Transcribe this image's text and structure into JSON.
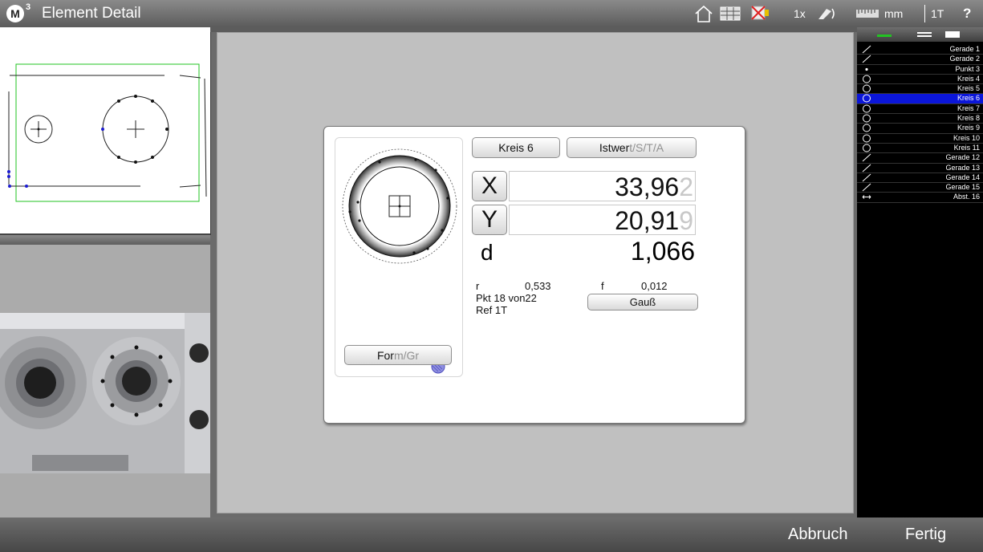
{
  "app": {
    "logo": "M",
    "logo_sup": "3",
    "title": "Element Detail"
  },
  "toolbar": {
    "zoom": "1x",
    "unit": "mm",
    "ref": "1T",
    "help": "?"
  },
  "dialog": {
    "name_button": "Kreis 6",
    "mode_button_main": "Istwer",
    "mode_button_dim": "t/S/T/A",
    "form_button_main": "For",
    "form_button_dim": "m/Gr",
    "x_label": "X",
    "x_value_main": "33,96",
    "x_value_ghost": "2",
    "y_label": "Y",
    "y_value_main": "20,91",
    "y_value_ghost": "9",
    "d_label": "d",
    "d_value": "1,066",
    "r_label": "r",
    "r_value": "0,533",
    "f_label": "f",
    "f_value": "0,012",
    "points": "Pkt 18 von22",
    "ref": "Ref 1T",
    "fit_button": "Gauß"
  },
  "elements": [
    {
      "icon": "line",
      "label": "Gerade 1"
    },
    {
      "icon": "line",
      "label": "Gerade 2"
    },
    {
      "icon": "point",
      "label": "Punkt 3"
    },
    {
      "icon": "circle",
      "label": "Kreis 4"
    },
    {
      "icon": "circle",
      "label": "Kreis 5"
    },
    {
      "icon": "circle",
      "label": "Kreis 6",
      "selected": true
    },
    {
      "icon": "circle",
      "label": "Kreis 7"
    },
    {
      "icon": "circle",
      "label": "Kreis 8"
    },
    {
      "icon": "circle",
      "label": "Kreis 9"
    },
    {
      "icon": "circle",
      "label": "Kreis 10"
    },
    {
      "icon": "circle",
      "label": "Kreis 11"
    },
    {
      "icon": "line",
      "label": "Gerade 12"
    },
    {
      "icon": "line",
      "label": "Gerade 13"
    },
    {
      "icon": "line",
      "label": "Gerade 14"
    },
    {
      "icon": "line",
      "label": "Gerade 15"
    },
    {
      "icon": "distance",
      "label": "Abst. 16"
    }
  ],
  "footer": {
    "cancel": "Abbruch",
    "done": "Fertig"
  },
  "colors": {
    "selection": "#0b16d9",
    "boundary": "#22c322",
    "marker": "#1b1bd0"
  }
}
